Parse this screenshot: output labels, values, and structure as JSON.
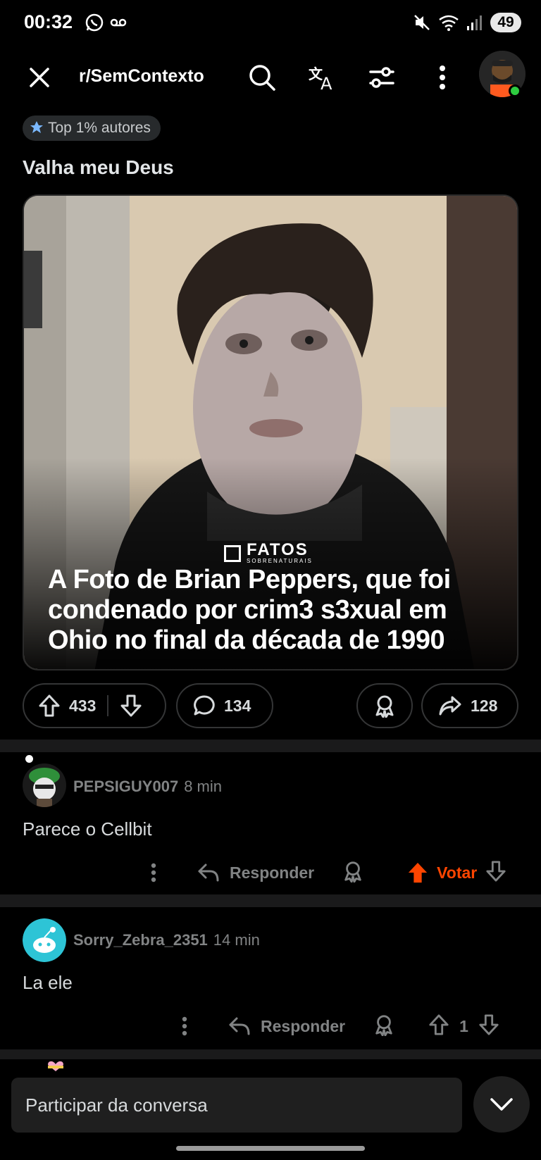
{
  "status_bar": {
    "time": "00:32",
    "battery": "49"
  },
  "header": {
    "subreddit": "r/SemContexto"
  },
  "post": {
    "flair": "Top 1% autores",
    "title": "Valha meu Deus",
    "image_watermark": "FATOS",
    "image_watermark_sub": "SOBRENATURAIS",
    "image_caption": "A Foto de Brian Peppers, que foi condenado por crim3 s3xual em Ohio no final da década de 1990",
    "upvotes": "433",
    "comments": "134",
    "shares": "128"
  },
  "comments": [
    {
      "user": "PEPSIGUY007",
      "time": "8 min",
      "body": "Parece o Cellbit",
      "reply_label": "Responder",
      "vote_label": "Votar",
      "accent": "#ff4500"
    },
    {
      "user": "Sorry_Zebra_2351",
      "time": "14 min",
      "body": "La ele",
      "reply_label": "Responder",
      "score": "1"
    }
  ],
  "compose": {
    "placeholder": "Participar da conversa"
  },
  "colors": {
    "background": "#000000",
    "accent": "#ff4500",
    "pill_border": "#343536",
    "muted": "#818384"
  }
}
